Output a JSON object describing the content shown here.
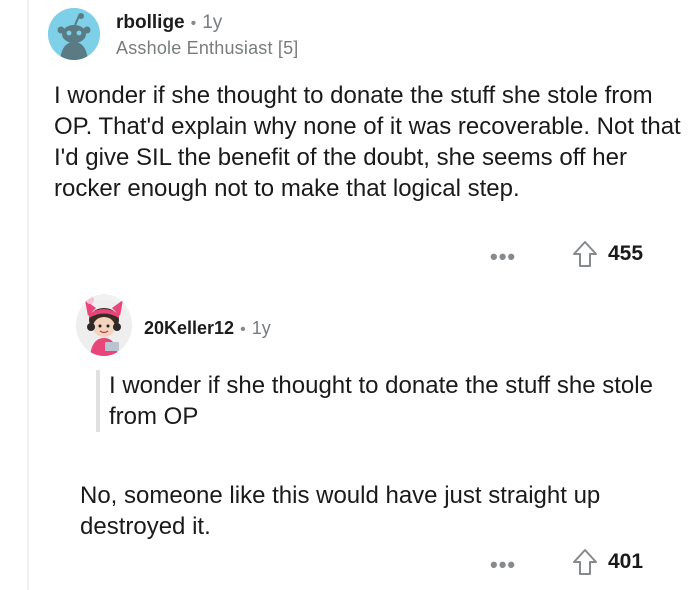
{
  "comment": {
    "username": "rbollige",
    "separator": "•",
    "age": "1y",
    "flair": "Asshole Enthusiast [5]",
    "body": "I wonder if she thought to donate the stuff she stole from OP.  That'd explain why none of it was recoverable.  Not that I'd give SIL the benefit of the doubt, she seems off her rocker enough not to make that logical step.",
    "more_label": "•••",
    "score": "455",
    "avatar_icon": "snoo-avatar-icon",
    "upvote_icon": "upvote-arrow-icon",
    "avatar_bg": "#7ecfe8"
  },
  "reply": {
    "username": "20Keller12",
    "separator": "•",
    "age": "1y",
    "quote": "I wonder if she thought to donate the stuff she stole from OP",
    "body": "No, someone like this would have just straight up destroyed it.",
    "more_label": "•••",
    "score": "401",
    "avatar_icon": "cartoon-avatar-icon",
    "upvote_icon": "upvote-arrow-icon"
  }
}
